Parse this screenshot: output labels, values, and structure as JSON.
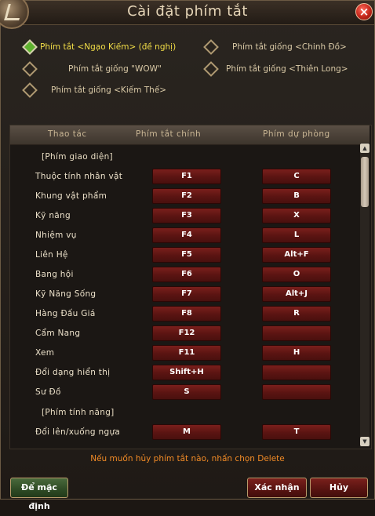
{
  "window": {
    "title": "Cài đặt phím tắt",
    "close_label": "×"
  },
  "options": [
    {
      "label": "Phím tắt <Ngạo Kiếm> (đề nghị)",
      "selected": true
    },
    {
      "label": "Phím tắt giống <Chinh Đồ>",
      "selected": false
    },
    {
      "label": "Phím tắt giống \"WOW\"",
      "selected": false
    },
    {
      "label": "Phím tắt giống <Thiên Long>",
      "selected": false
    },
    {
      "label": "Phím tắt giống <Kiếm Thế>",
      "selected": false
    }
  ],
  "table": {
    "headers": [
      "Thao tác",
      "Phím tắt chính",
      "Phím dự phòng"
    ],
    "sections": [
      "[Phím giao diện]",
      "[Phím tính năng]"
    ],
    "rows": [
      {
        "action": "Thuộc tính nhân vật",
        "primary": "F1",
        "secondary": "C"
      },
      {
        "action": "Khung vật phẩm",
        "primary": "F2",
        "secondary": "B"
      },
      {
        "action": "Kỹ năng",
        "primary": "F3",
        "secondary": "X"
      },
      {
        "action": "Nhiệm vụ",
        "primary": "F4",
        "secondary": "L"
      },
      {
        "action": "Liên Hệ",
        "primary": "F5",
        "secondary": "Alt+F"
      },
      {
        "action": "Bang hội",
        "primary": "F6",
        "secondary": "O"
      },
      {
        "action": "Kỹ Năng Sống",
        "primary": "F7",
        "secondary": "Alt+J"
      },
      {
        "action": "Hàng Đấu Giá",
        "primary": "F8",
        "secondary": "R"
      },
      {
        "action": "Cẩm Nang",
        "primary": "F12",
        "secondary": ""
      },
      {
        "action": "Xem",
        "primary": "F11",
        "secondary": "H"
      },
      {
        "action": "Đổi dạng hiển thị",
        "primary": "Shift+H",
        "secondary": ""
      },
      {
        "action": "Sư Đồ",
        "primary": "S",
        "secondary": ""
      },
      {
        "action": "Đổi lên/xuống ngựa",
        "primary": "M",
        "secondary": "T"
      }
    ]
  },
  "hint": "Nếu muốn hủy phím tắt nào, nhấn chọn Delete",
  "buttons": {
    "default": "Để mặc định",
    "confirm": "Xác nhận",
    "cancel": "Hủy"
  },
  "icons": {
    "logo": "game-logo-icon",
    "close": "close-icon",
    "selected_option": "diamond-selected-icon",
    "unselected_option": "diamond-icon",
    "scroll_up": "scroll-up-arrow-icon",
    "scroll_down": "scroll-down-arrow-icon"
  },
  "colors": {
    "accent_gold": "#f3de47",
    "hint_orange": "#f08a26",
    "key_red": "#5a1412",
    "close_red": "#c4261a",
    "selected_green": "#5eb22f"
  }
}
